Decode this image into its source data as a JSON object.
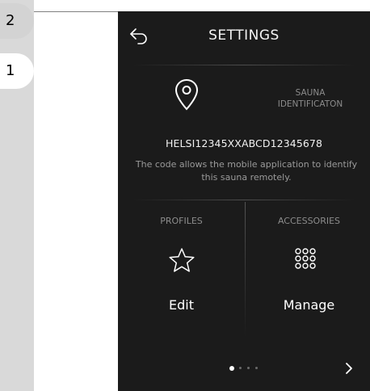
{
  "callouts": [
    "2",
    "1"
  ],
  "screen": {
    "title": "SETTINGS",
    "sauna_id": {
      "label_line1": "SAUNA",
      "label_line2": "IDENTIFICATON",
      "code": "HELSI12345XXABCD12345678",
      "description": "The code allows the mobile application to identify this sauna remotely."
    },
    "profiles": {
      "header": "PROFILES",
      "action": "Edit"
    },
    "accessories": {
      "header": "ACCESSORIES",
      "action": "Manage"
    },
    "pager": {
      "pages": 4,
      "current": 0
    }
  },
  "icons": {
    "back": "back-arrow-icon",
    "location": "location-pin-icon",
    "profiles": "star-icon",
    "accessories": "grid-dots-icon",
    "next": "chevron-right-icon"
  },
  "colors": {
    "screen_background": "#1b1b1b",
    "primary_text": "#ffffff",
    "secondary_text": "#8c8c8c",
    "callout_background": "#d3d3d3"
  }
}
